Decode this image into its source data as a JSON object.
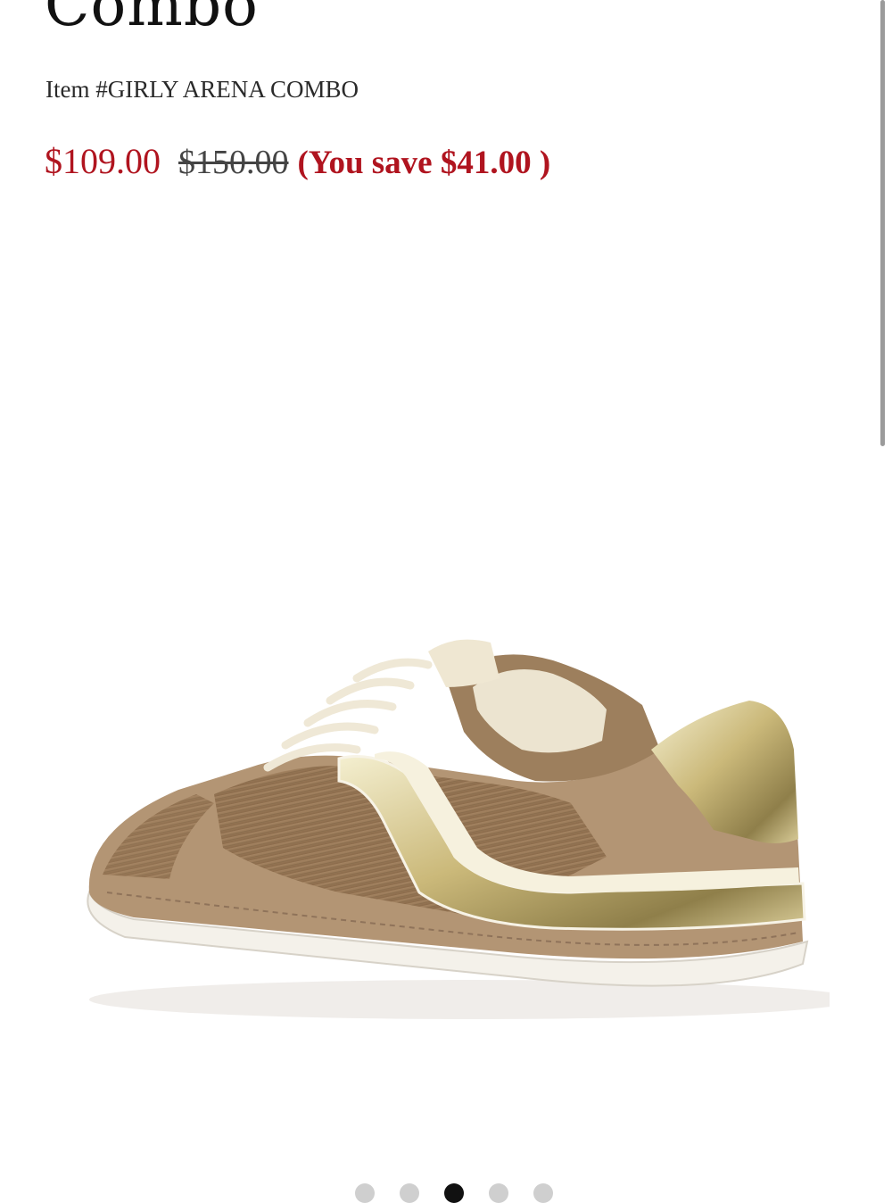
{
  "product": {
    "title": "Combo",
    "item_number": "Item #GIRLY ARENA COMBO",
    "sale_price": "$109.00",
    "original_price": "$150.00",
    "savings_text": "(You save $41.00 )",
    "image_alt": "sneaker-image"
  },
  "colors": {
    "sale": "#b0141f",
    "strike": "#444444"
  },
  "carousel": {
    "count": 5,
    "active_index": 2
  }
}
